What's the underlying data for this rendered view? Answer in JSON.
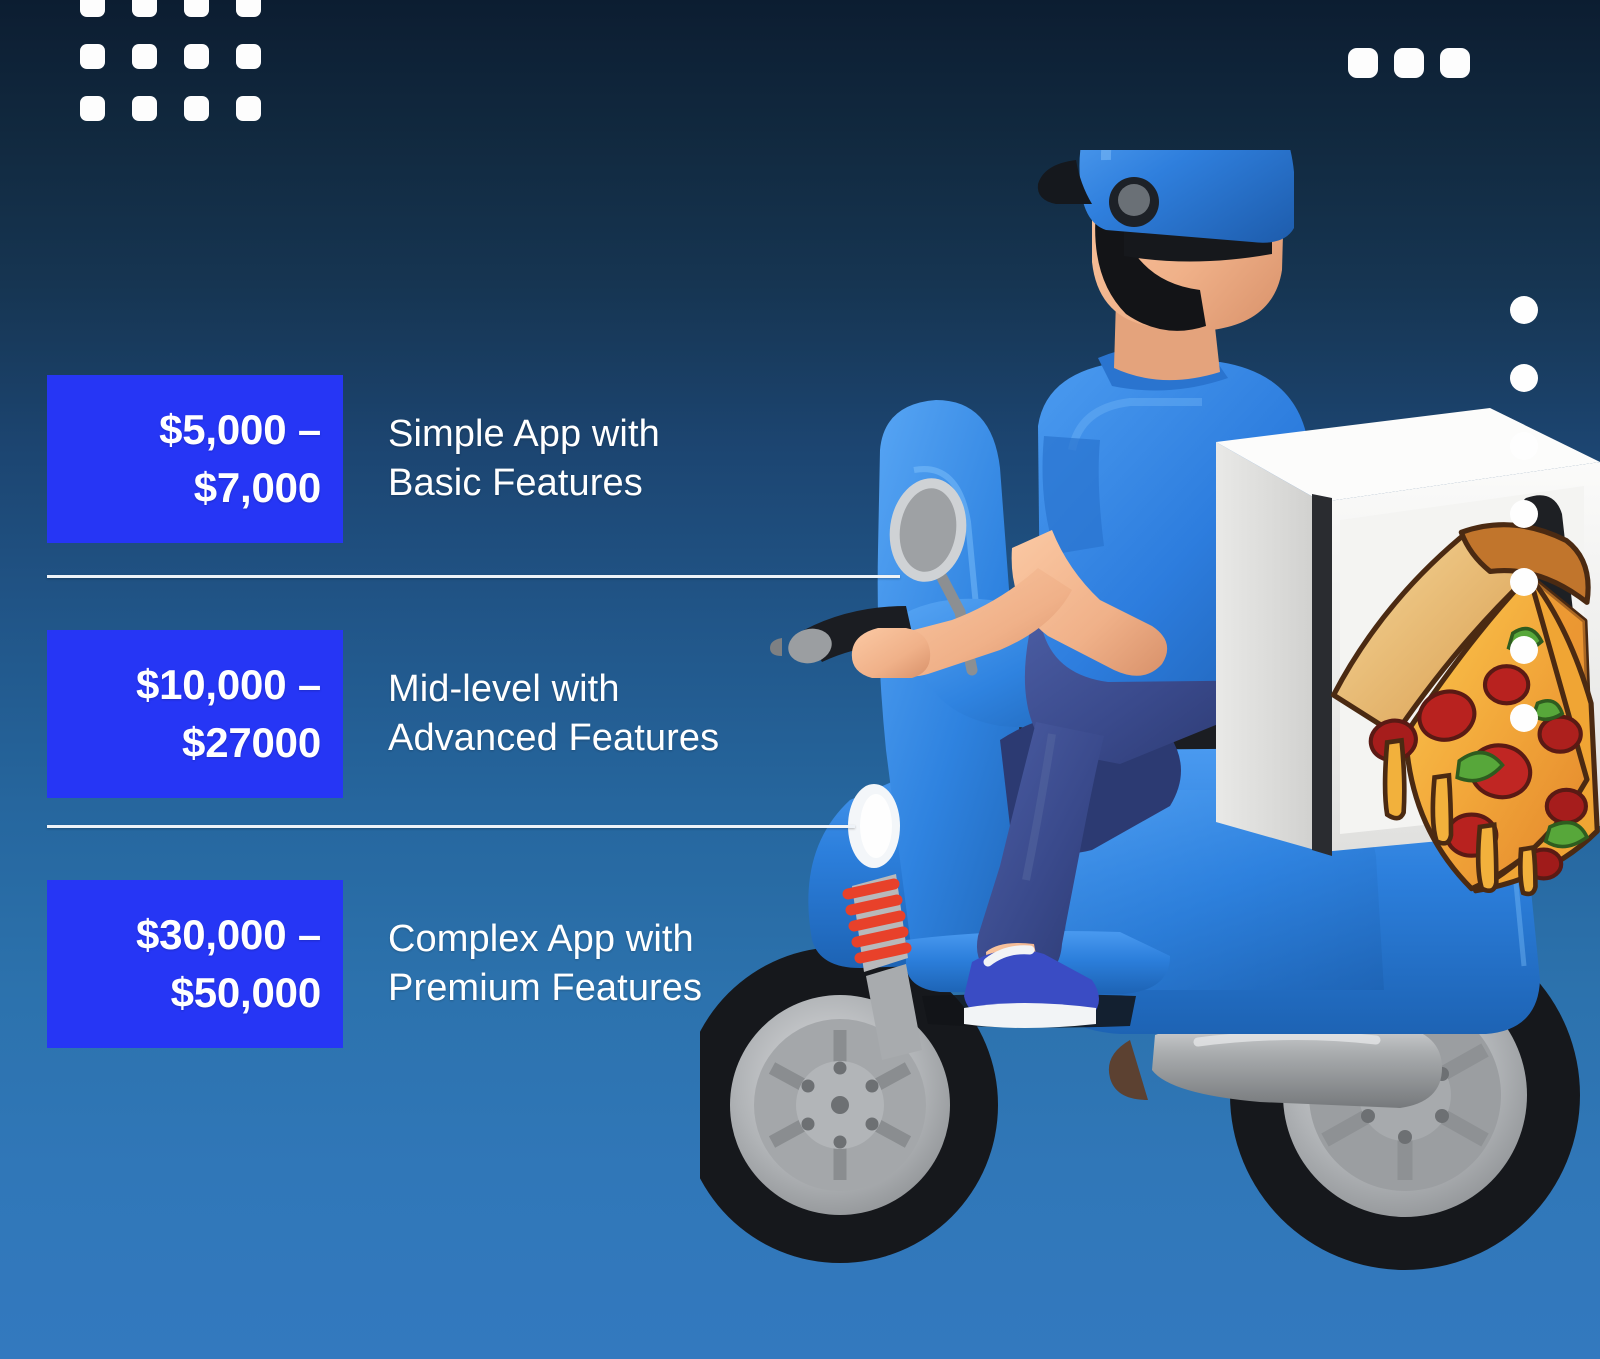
{
  "theme": {
    "bg_top": "#0c1d31",
    "bg_bottom": "#3379bf",
    "badge_bg": "#2636f5",
    "text": "#ffffff",
    "divider": "#eef3f8",
    "scooter_blue": "#2b7fe0",
    "helmet_blue": "#2f7fdd",
    "shirt_blue": "#2e7ede",
    "pants_navy": "#3a4a8c",
    "skin": "#f0b48c",
    "box_white": "#f1f1ef",
    "accent_red": "#e8412a",
    "tire_black": "#14161a",
    "rim_silver": "#b9bcbe"
  },
  "decor": {
    "dot_grid_label": "dot-grid-4x3",
    "dot_grid_count": 12,
    "top_right_dots_count": 3,
    "edge_dots_count": 7
  },
  "pricing": {
    "tiers": [
      {
        "id": "tier-basic",
        "price": "$5,000 –\n$7,000",
        "description": "Simple App with\nBasic Features"
      },
      {
        "id": "tier-mid",
        "price": "$10,000 –\n$27000",
        "description": "Mid-level with\nAdvanced Features"
      },
      {
        "id": "tier-premium",
        "price": "$30,000 –\n$50,000",
        "description": "Complex App with\nPremium Features"
      }
    ]
  },
  "illustration": {
    "name": "pizza-delivery-scooter-rider",
    "rider": "delivery-man-with-helmet-and-beard",
    "vehicle": "blue-scooter",
    "cargo": "white-delivery-box-with-pizza-slice-graphic"
  }
}
